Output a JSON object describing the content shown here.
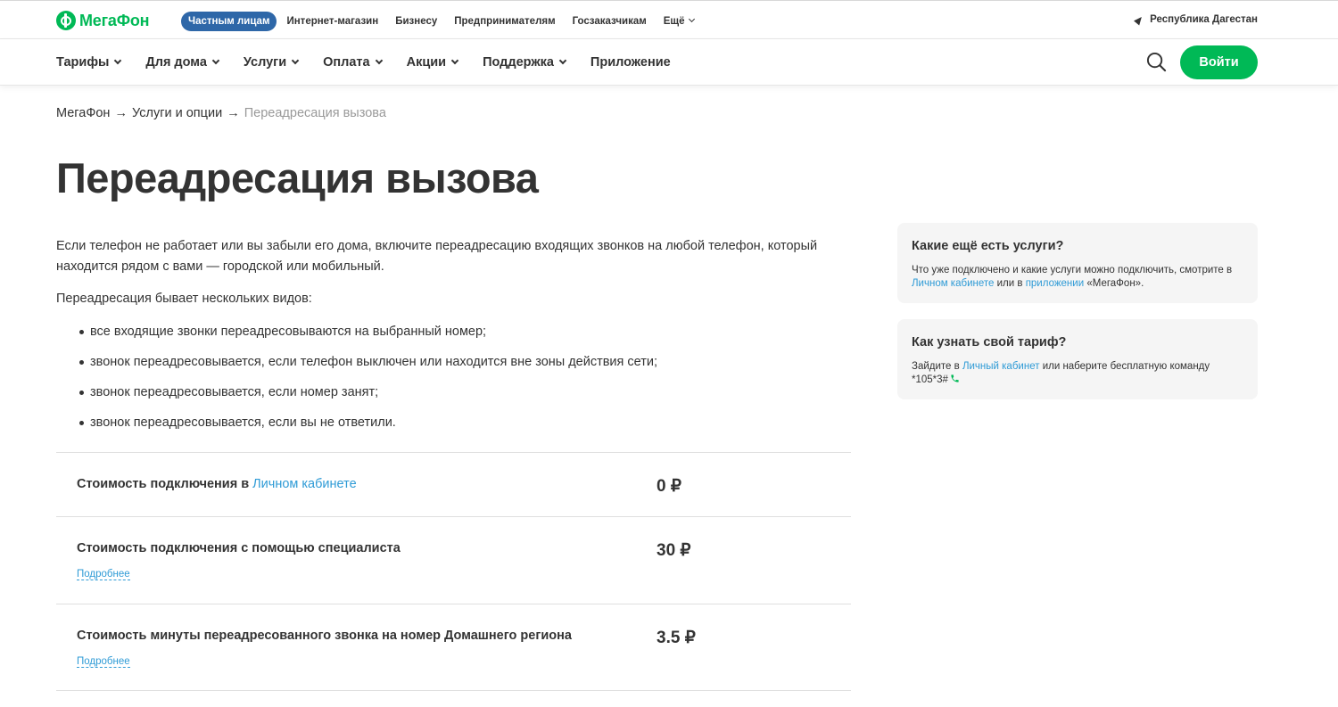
{
  "logo": {
    "text": "МегаФон"
  },
  "segments": {
    "active": "Частным лицам",
    "items": [
      "Интернет-магазин",
      "Бизнесу",
      "Предпринимателям",
      "Госзаказчикам"
    ],
    "more": "Ещё"
  },
  "region": {
    "label": "Республика Дагестан"
  },
  "nav": {
    "items": [
      "Тарифы",
      "Для дома",
      "Услуги",
      "Оплата",
      "Акции",
      "Поддержка"
    ],
    "app": "Приложение",
    "login": "Войти"
  },
  "breadcrumb": {
    "items": [
      "МегаФон",
      "Услуги и опции"
    ],
    "current": "Переадресация вызова",
    "separator": "→"
  },
  "page": {
    "title": "Переадресация вызова",
    "intro": "Если телефон не работает или вы забыли его дома, включите переадресацию входящих звонков на любой телефон, который находится рядом с вами — городской или мобильный.",
    "types_intro": "Переадресация бывает нескольких видов:",
    "types": [
      "все входящие звонки переадресовываются на выбранный номер;",
      "звонок переадресовывается, если телефон выключен или находится вне зоны действия сети;",
      "звонок переадресовывается, если номер занят;",
      "звонок переадресовывается, если вы не ответили."
    ]
  },
  "prices": [
    {
      "label": "Стоимость подключения в",
      "link": "Личном кабинете",
      "price": "0 ₽"
    },
    {
      "label": "Стоимость подключения с помощью специалиста",
      "more": "Подробнее",
      "price": "30 ₽"
    },
    {
      "label": "Стоимость минуты переадресованного звонка на номер Домашнего региона",
      "more": "Подробнее",
      "price": "3.5 ₽"
    }
  ],
  "sidebar": {
    "card1": {
      "title": "Какие ещё есть услуги?",
      "text1": "Что уже подключено и какие услуги можно подключить, смотрите в",
      "link1": "Личном кабинете",
      "text2": "или в",
      "link2": "приложении",
      "text3": "«МегаФон»."
    },
    "card2": {
      "title": "Как узнать свой тариф?",
      "text1": "Зайдите в",
      "link1": "Личный кабинет",
      "text2": "или наберите бесплатную команду",
      "command": "*105*3#"
    }
  },
  "colors": {
    "brand": "#00b956",
    "segment_active": "#2e67a8",
    "link": "#2f9bd6"
  },
  "icons": [
    "logo-mark-icon",
    "location-arrow-icon",
    "search-icon",
    "phone-icon",
    "chevron-down-icon"
  ]
}
